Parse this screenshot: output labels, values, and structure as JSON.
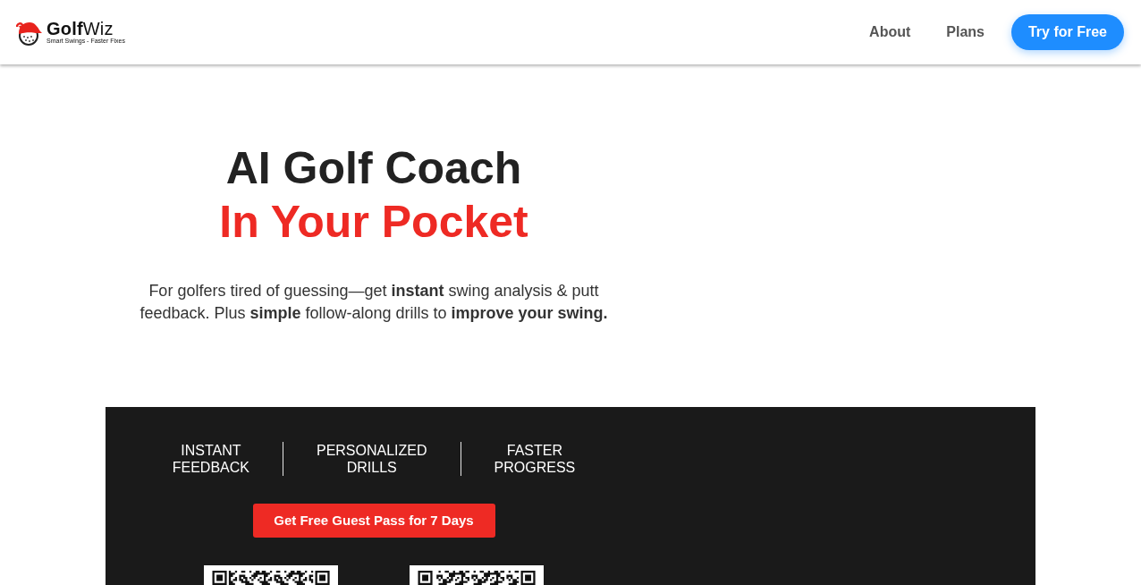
{
  "header": {
    "logo": {
      "name": "**Golf**Wiz",
      "tagline": "Smart Swings - Faster Fixes"
    },
    "nav": [
      {
        "label": "About"
      },
      {
        "label": "Plans"
      }
    ],
    "cta": "Try for Free"
  },
  "hero": {
    "title": "AI Golf Coach",
    "title_highlight": "In Your Pocket",
    "description": "For golfers tired of guessing—get **instant** swing analysis & putt feedback. Plus **simple** follow-along drills to **improve your swing.**"
  },
  "promo": {
    "features": [
      "INSTANT FEEDBACK",
      "PERSONALIZED DRILLS",
      "FASTER PROGRESS"
    ],
    "button": "Get Free Guest Pass for 7 Days"
  }
}
